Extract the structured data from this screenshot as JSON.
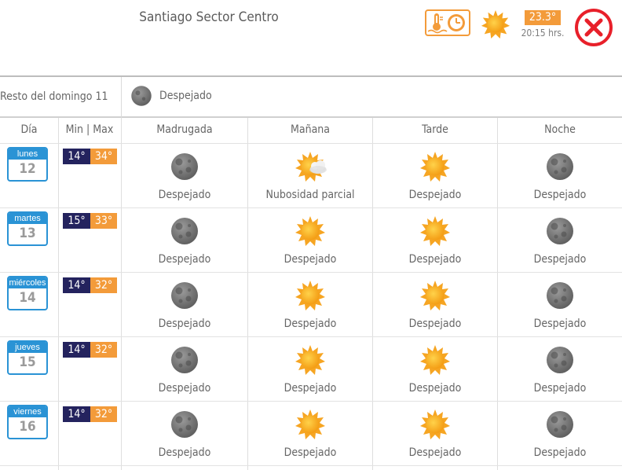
{
  "header": {
    "location": "Santiago Sector Centro",
    "current_temp": "23.3°",
    "time": "20:15 hrs.",
    "current_icon": "sun-icon",
    "warn_icon": "thermometer-clock-icon",
    "close_icon": "close-icon"
  },
  "rest_of_day": {
    "label": "Resto del domingo 11",
    "condition": "Despejado",
    "icon": "moon-icon"
  },
  "columns": {
    "day": "Día",
    "minmax": "Min | Max",
    "periods": [
      "Madrugada",
      "Mañana",
      "Tarde",
      "Noche"
    ]
  },
  "days": [
    {
      "name": "lunes",
      "number": "12",
      "min": "14°",
      "max": "34°",
      "periods": [
        {
          "icon": "moon-icon",
          "condition": "Despejado"
        },
        {
          "icon": "sun-cloud-icon",
          "condition": "Nubosidad parcial"
        },
        {
          "icon": "sun-icon",
          "condition": "Despejado"
        },
        {
          "icon": "moon-icon",
          "condition": "Despejado"
        }
      ]
    },
    {
      "name": "martes",
      "number": "13",
      "min": "15°",
      "max": "33°",
      "periods": [
        {
          "icon": "moon-icon",
          "condition": "Despejado"
        },
        {
          "icon": "sun-icon",
          "condition": "Despejado"
        },
        {
          "icon": "sun-icon",
          "condition": "Despejado"
        },
        {
          "icon": "moon-icon",
          "condition": "Despejado"
        }
      ]
    },
    {
      "name": "miércoles",
      "number": "14",
      "min": "14°",
      "max": "32°",
      "periods": [
        {
          "icon": "moon-icon",
          "condition": "Despejado"
        },
        {
          "icon": "sun-icon",
          "condition": "Despejado"
        },
        {
          "icon": "sun-icon",
          "condition": "Despejado"
        },
        {
          "icon": "moon-icon",
          "condition": "Despejado"
        }
      ]
    },
    {
      "name": "jueves",
      "number": "15",
      "min": "14°",
      "max": "32°",
      "periods": [
        {
          "icon": "moon-icon",
          "condition": "Despejado"
        },
        {
          "icon": "sun-icon",
          "condition": "Despejado"
        },
        {
          "icon": "sun-icon",
          "condition": "Despejado"
        },
        {
          "icon": "moon-icon",
          "condition": "Despejado"
        }
      ]
    },
    {
      "name": "viernes",
      "number": "16",
      "min": "14°",
      "max": "32°",
      "periods": [
        {
          "icon": "moon-icon",
          "condition": "Despejado"
        },
        {
          "icon": "sun-icon",
          "condition": "Despejado"
        },
        {
          "icon": "sun-icon",
          "condition": "Despejado"
        },
        {
          "icon": "moon-icon",
          "condition": "Despejado"
        }
      ]
    }
  ],
  "colors": {
    "accent_orange": "#f39b3a",
    "min_navy": "#24235e",
    "day_blue": "#2a93d5",
    "close_red": "#e8202a"
  }
}
